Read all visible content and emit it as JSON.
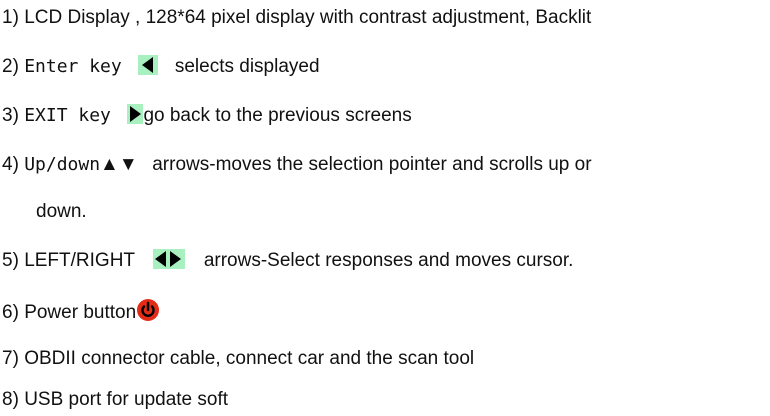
{
  "items": [
    {
      "num": "1)",
      "text": "LCD Display , 128*64 pixel display with contrast adjustment, Backlit"
    },
    {
      "num": "2)",
      "key": "Enter key",
      "text": "selects displayed",
      "icon": "left-triangle-icon"
    },
    {
      "num": "3)",
      "key": "EXIT key",
      "text": "go back to the previous screens",
      "icon": "right-triangle-icon"
    },
    {
      "num": "4)",
      "key": "Up/down",
      "arrows": "▲▼",
      "text": "arrows-moves the selection pointer and scrolls up or",
      "text2": "down."
    },
    {
      "num": "5)",
      "text_pre": "LEFT/RIGHT",
      "text": "arrows-Select responses and moves cursor.",
      "icon": "left-right-triangles-icon"
    },
    {
      "num": "6)",
      "text": "Power button",
      "icon": "power-icon"
    },
    {
      "num": "7)",
      "text": "OBDII connector cable, connect car and the scan tool"
    },
    {
      "num": "8)",
      "text": "USB port for update soft"
    }
  ],
  "colors": {
    "key_box": "#a8f0c0",
    "power": "#e32b16"
  }
}
